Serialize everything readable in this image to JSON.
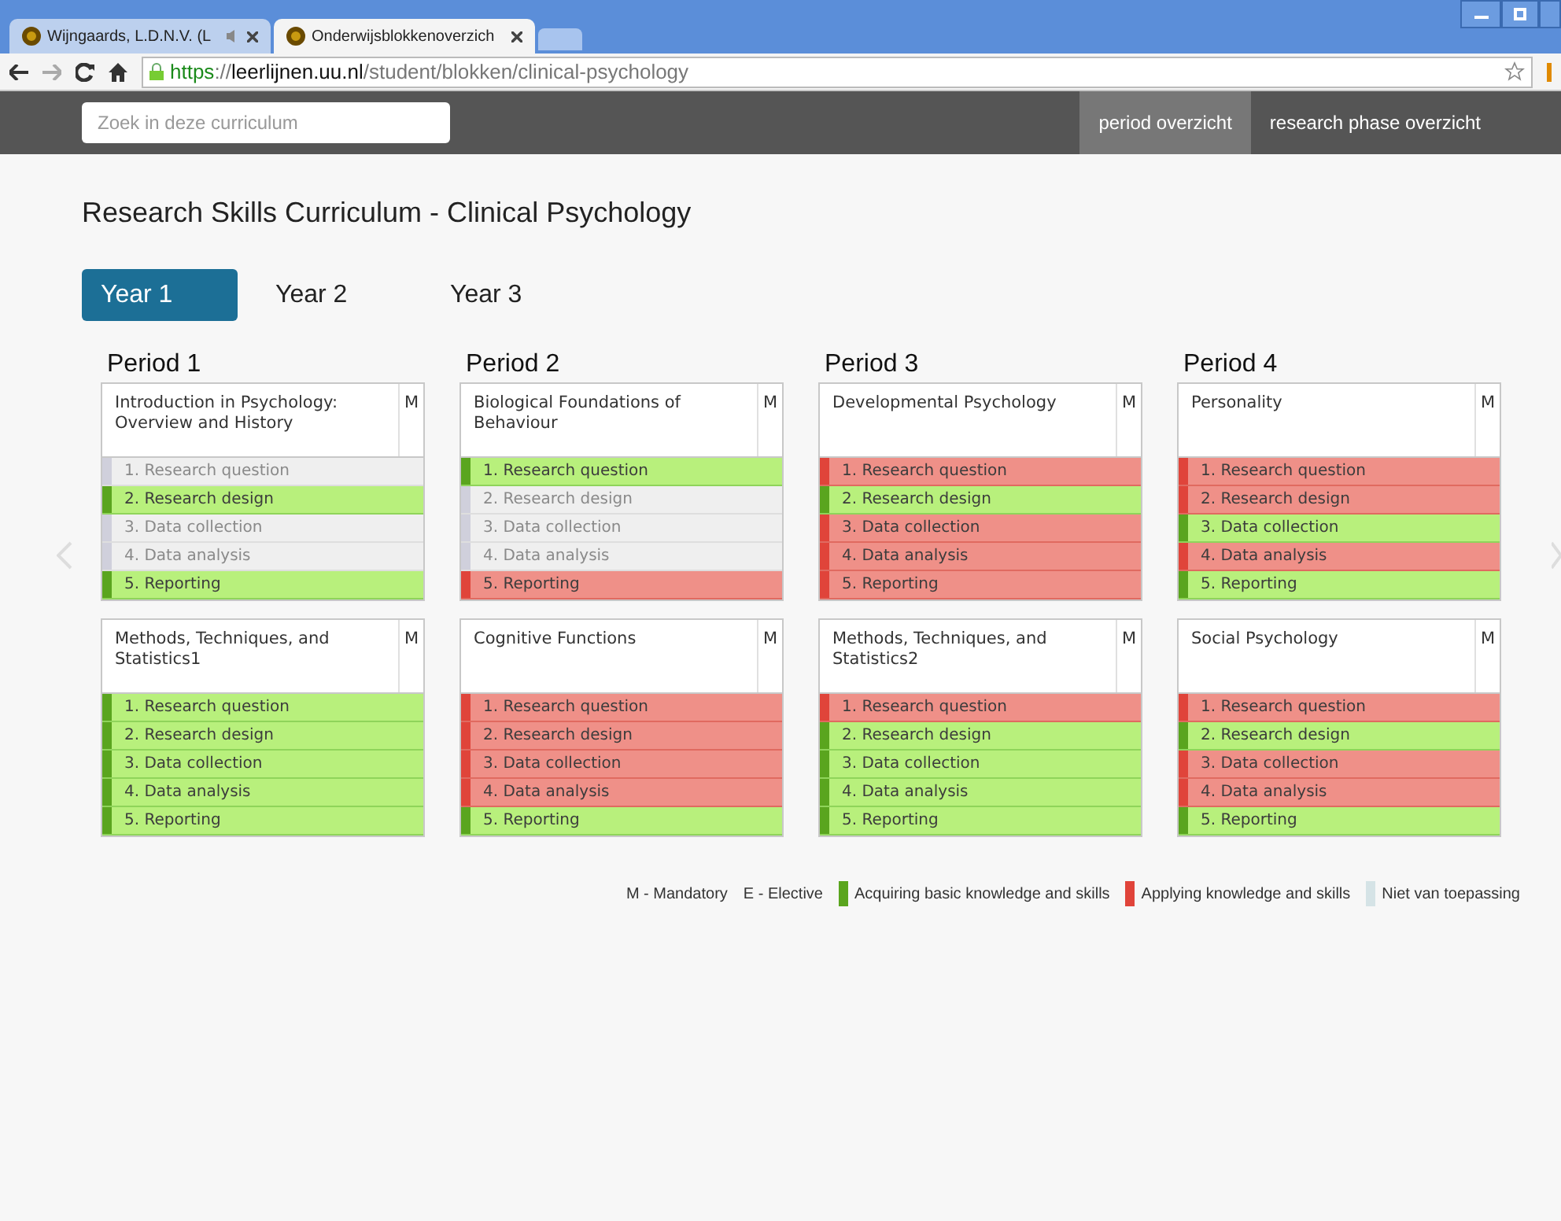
{
  "browser": {
    "tabs": [
      {
        "title": "Wijngaards, L.D.N.V. (L",
        "selected": false,
        "audio": true
      },
      {
        "title": "Onderwijsblokkenoverzich",
        "selected": true,
        "audio": false
      }
    ],
    "url": {
      "scheme": "https",
      "sep": "://",
      "host": "leerlijnen.uu.nl",
      "path": "/student/blokken/clinical-psychology"
    }
  },
  "navbar": {
    "search": {
      "placeholder": "Zoek in deze curriculum"
    },
    "links": [
      {
        "label": "period overzicht",
        "selected": true
      },
      {
        "label": "research phase overzicht",
        "selected": false
      }
    ]
  },
  "title": "Research Skills Curriculum - Clinical Psychology",
  "years": [
    {
      "label": "Year 1",
      "selected": true
    },
    {
      "label": "Year 2",
      "selected": false
    },
    {
      "label": "Year 3",
      "selected": false
    }
  ],
  "periods": [
    {
      "title": "Period 1",
      "courses": [
        {
          "name": "Introduction in Psychology: Overview and History",
          "type": "M",
          "phases": [
            {
              "label": "1. Research question",
              "kind": "na"
            },
            {
              "label": "2. Research design",
              "kind": "acquiring"
            },
            {
              "label": "3. Data collection",
              "kind": "na"
            },
            {
              "label": "4. Data analysis",
              "kind": "na"
            },
            {
              "label": "5. Reporting",
              "kind": "acquiring"
            }
          ]
        },
        {
          "name": "Methods, Techniques, and Statistics1",
          "type": "M",
          "phases": [
            {
              "label": "1. Research question",
              "kind": "acquiring"
            },
            {
              "label": "2. Research design",
              "kind": "acquiring"
            },
            {
              "label": "3. Data collection",
              "kind": "acquiring"
            },
            {
              "label": "4. Data analysis",
              "kind": "acquiring"
            },
            {
              "label": "5. Reporting",
              "kind": "acquiring"
            }
          ]
        }
      ]
    },
    {
      "title": "Period 2",
      "courses": [
        {
          "name": "Biological Foundations of Behaviour",
          "type": "M",
          "phases": [
            {
              "label": "1. Research question",
              "kind": "acquiring"
            },
            {
              "label": "2. Research design",
              "kind": "na"
            },
            {
              "label": "3. Data collection",
              "kind": "na"
            },
            {
              "label": "4. Data analysis",
              "kind": "na"
            },
            {
              "label": "5. Reporting",
              "kind": "applying"
            }
          ]
        },
        {
          "name": "Cognitive Functions",
          "type": "M",
          "phases": [
            {
              "label": "1. Research question",
              "kind": "applying"
            },
            {
              "label": "2. Research design",
              "kind": "applying"
            },
            {
              "label": "3. Data collection",
              "kind": "applying"
            },
            {
              "label": "4. Data analysis",
              "kind": "applying"
            },
            {
              "label": "5. Reporting",
              "kind": "acquiring"
            }
          ]
        }
      ]
    },
    {
      "title": "Period 3",
      "courses": [
        {
          "name": "Developmental Psychology",
          "type": "M",
          "phases": [
            {
              "label": "1. Research question",
              "kind": "applying"
            },
            {
              "label": "2. Research design",
              "kind": "acquiring"
            },
            {
              "label": "3. Data collection",
              "kind": "applying"
            },
            {
              "label": "4. Data analysis",
              "kind": "applying"
            },
            {
              "label": "5. Reporting",
              "kind": "applying"
            }
          ]
        },
        {
          "name": "Methods, Techniques, and Statistics2",
          "type": "M",
          "phases": [
            {
              "label": "1. Research question",
              "kind": "applying"
            },
            {
              "label": "2. Research design",
              "kind": "acquiring"
            },
            {
              "label": "3. Data collection",
              "kind": "acquiring"
            },
            {
              "label": "4. Data analysis",
              "kind": "acquiring"
            },
            {
              "label": "5. Reporting",
              "kind": "acquiring"
            }
          ]
        }
      ]
    },
    {
      "title": "Period 4",
      "courses": [
        {
          "name": "Personality",
          "type": "M",
          "phases": [
            {
              "label": "1. Research question",
              "kind": "applying"
            },
            {
              "label": "2. Research design",
              "kind": "applying"
            },
            {
              "label": "3. Data collection",
              "kind": "acquiring"
            },
            {
              "label": "4. Data analysis",
              "kind": "applying"
            },
            {
              "label": "5. Reporting",
              "kind": "acquiring"
            }
          ]
        },
        {
          "name": "Social Psychology",
          "type": "M",
          "phases": [
            {
              "label": "1. Research question",
              "kind": "applying"
            },
            {
              "label": "2. Research design",
              "kind": "acquiring"
            },
            {
              "label": "3. Data collection",
              "kind": "applying"
            },
            {
              "label": "4. Data analysis",
              "kind": "applying"
            },
            {
              "label": "5. Reporting",
              "kind": "acquiring"
            }
          ]
        }
      ]
    }
  ],
  "legend": [
    {
      "kind": "text",
      "label": "M - Mandatory"
    },
    {
      "kind": "text",
      "label": "E - Elective"
    },
    {
      "kind": "swatch",
      "label": "Acquiring basic knowledge and skills",
      "color": "#5aa51e"
    },
    {
      "kind": "swatch",
      "label": "Applying knowledge and skills",
      "color": "#e0443a"
    },
    {
      "kind": "swatch",
      "label": "Niet van toepassing",
      "color": "#d5e3e6"
    }
  ]
}
